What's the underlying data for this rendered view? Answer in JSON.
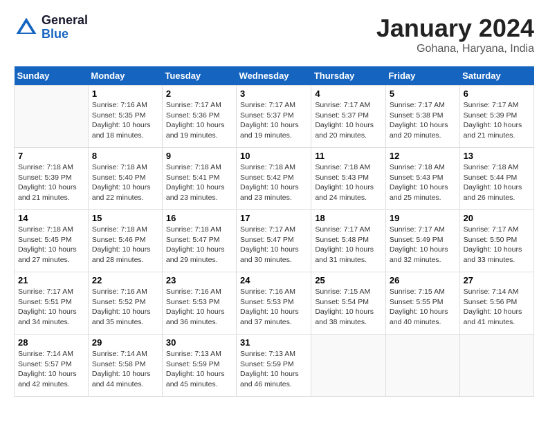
{
  "header": {
    "logo_general": "General",
    "logo_blue": "Blue",
    "month": "January 2024",
    "location": "Gohana, Haryana, India"
  },
  "days_of_week": [
    "Sunday",
    "Monday",
    "Tuesday",
    "Wednesday",
    "Thursday",
    "Friday",
    "Saturday"
  ],
  "weeks": [
    [
      {
        "day": "",
        "info": ""
      },
      {
        "day": "1",
        "info": "Sunrise: 7:16 AM\nSunset: 5:35 PM\nDaylight: 10 hours\nand 18 minutes."
      },
      {
        "day": "2",
        "info": "Sunrise: 7:17 AM\nSunset: 5:36 PM\nDaylight: 10 hours\nand 19 minutes."
      },
      {
        "day": "3",
        "info": "Sunrise: 7:17 AM\nSunset: 5:37 PM\nDaylight: 10 hours\nand 19 minutes."
      },
      {
        "day": "4",
        "info": "Sunrise: 7:17 AM\nSunset: 5:37 PM\nDaylight: 10 hours\nand 20 minutes."
      },
      {
        "day": "5",
        "info": "Sunrise: 7:17 AM\nSunset: 5:38 PM\nDaylight: 10 hours\nand 20 minutes."
      },
      {
        "day": "6",
        "info": "Sunrise: 7:17 AM\nSunset: 5:39 PM\nDaylight: 10 hours\nand 21 minutes."
      }
    ],
    [
      {
        "day": "7",
        "info": "Sunrise: 7:18 AM\nSunset: 5:39 PM\nDaylight: 10 hours\nand 21 minutes."
      },
      {
        "day": "8",
        "info": "Sunrise: 7:18 AM\nSunset: 5:40 PM\nDaylight: 10 hours\nand 22 minutes."
      },
      {
        "day": "9",
        "info": "Sunrise: 7:18 AM\nSunset: 5:41 PM\nDaylight: 10 hours\nand 23 minutes."
      },
      {
        "day": "10",
        "info": "Sunrise: 7:18 AM\nSunset: 5:42 PM\nDaylight: 10 hours\nand 23 minutes."
      },
      {
        "day": "11",
        "info": "Sunrise: 7:18 AM\nSunset: 5:43 PM\nDaylight: 10 hours\nand 24 minutes."
      },
      {
        "day": "12",
        "info": "Sunrise: 7:18 AM\nSunset: 5:43 PM\nDaylight: 10 hours\nand 25 minutes."
      },
      {
        "day": "13",
        "info": "Sunrise: 7:18 AM\nSunset: 5:44 PM\nDaylight: 10 hours\nand 26 minutes."
      }
    ],
    [
      {
        "day": "14",
        "info": "Sunrise: 7:18 AM\nSunset: 5:45 PM\nDaylight: 10 hours\nand 27 minutes."
      },
      {
        "day": "15",
        "info": "Sunrise: 7:18 AM\nSunset: 5:46 PM\nDaylight: 10 hours\nand 28 minutes."
      },
      {
        "day": "16",
        "info": "Sunrise: 7:18 AM\nSunset: 5:47 PM\nDaylight: 10 hours\nand 29 minutes."
      },
      {
        "day": "17",
        "info": "Sunrise: 7:17 AM\nSunset: 5:47 PM\nDaylight: 10 hours\nand 30 minutes."
      },
      {
        "day": "18",
        "info": "Sunrise: 7:17 AM\nSunset: 5:48 PM\nDaylight: 10 hours\nand 31 minutes."
      },
      {
        "day": "19",
        "info": "Sunrise: 7:17 AM\nSunset: 5:49 PM\nDaylight: 10 hours\nand 32 minutes."
      },
      {
        "day": "20",
        "info": "Sunrise: 7:17 AM\nSunset: 5:50 PM\nDaylight: 10 hours\nand 33 minutes."
      }
    ],
    [
      {
        "day": "21",
        "info": "Sunrise: 7:17 AM\nSunset: 5:51 PM\nDaylight: 10 hours\nand 34 minutes."
      },
      {
        "day": "22",
        "info": "Sunrise: 7:16 AM\nSunset: 5:52 PM\nDaylight: 10 hours\nand 35 minutes."
      },
      {
        "day": "23",
        "info": "Sunrise: 7:16 AM\nSunset: 5:53 PM\nDaylight: 10 hours\nand 36 minutes."
      },
      {
        "day": "24",
        "info": "Sunrise: 7:16 AM\nSunset: 5:53 PM\nDaylight: 10 hours\nand 37 minutes."
      },
      {
        "day": "25",
        "info": "Sunrise: 7:15 AM\nSunset: 5:54 PM\nDaylight: 10 hours\nand 38 minutes."
      },
      {
        "day": "26",
        "info": "Sunrise: 7:15 AM\nSunset: 5:55 PM\nDaylight: 10 hours\nand 40 minutes."
      },
      {
        "day": "27",
        "info": "Sunrise: 7:14 AM\nSunset: 5:56 PM\nDaylight: 10 hours\nand 41 minutes."
      }
    ],
    [
      {
        "day": "28",
        "info": "Sunrise: 7:14 AM\nSunset: 5:57 PM\nDaylight: 10 hours\nand 42 minutes."
      },
      {
        "day": "29",
        "info": "Sunrise: 7:14 AM\nSunset: 5:58 PM\nDaylight: 10 hours\nand 44 minutes."
      },
      {
        "day": "30",
        "info": "Sunrise: 7:13 AM\nSunset: 5:59 PM\nDaylight: 10 hours\nand 45 minutes."
      },
      {
        "day": "31",
        "info": "Sunrise: 7:13 AM\nSunset: 5:59 PM\nDaylight: 10 hours\nand 46 minutes."
      },
      {
        "day": "",
        "info": ""
      },
      {
        "day": "",
        "info": ""
      },
      {
        "day": "",
        "info": ""
      }
    ]
  ]
}
